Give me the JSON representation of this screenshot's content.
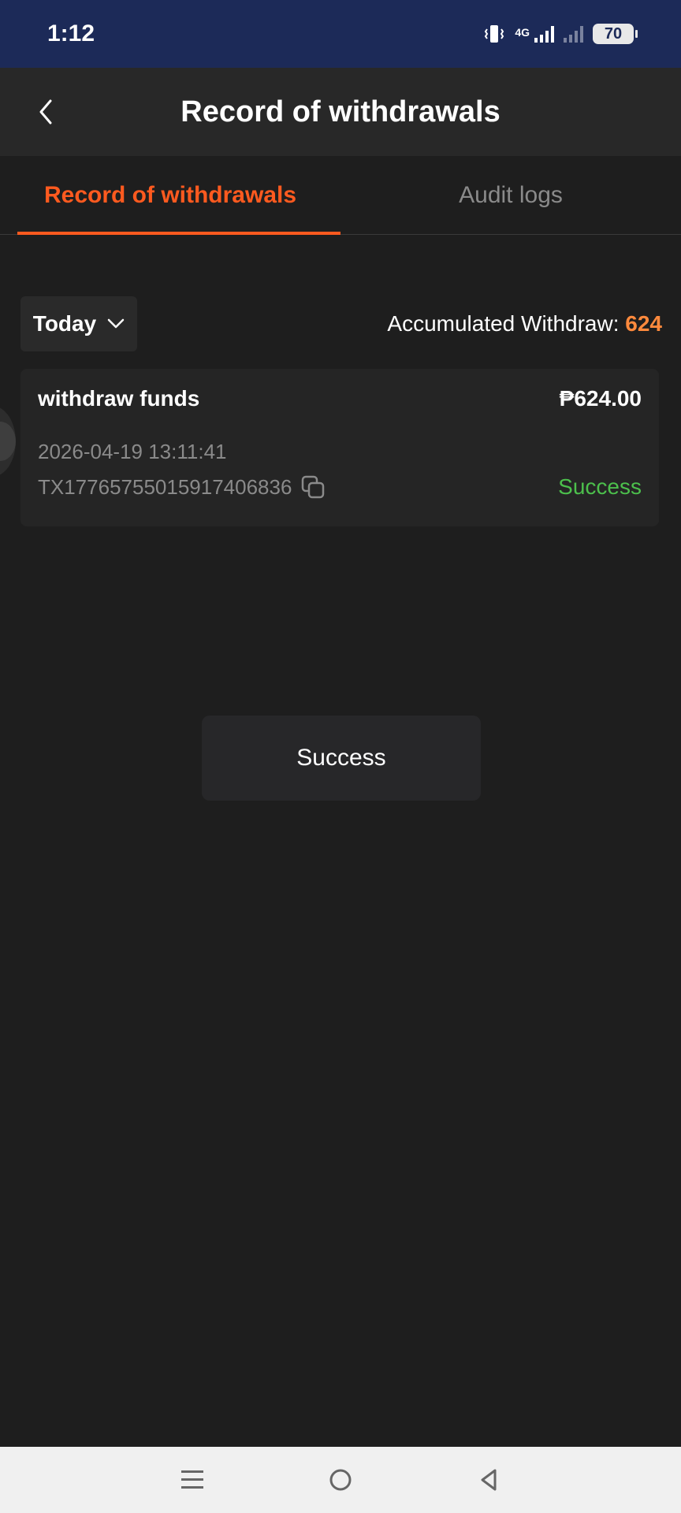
{
  "status_bar": {
    "time": "1:12",
    "network": "4G",
    "battery": "70"
  },
  "header": {
    "title": "Record of withdrawals"
  },
  "tabs": [
    {
      "label": "Record of withdrawals",
      "active": true
    },
    {
      "label": "Audit logs",
      "active": false
    }
  ],
  "filter": {
    "date_label": "Today",
    "accumulated_label": "Accumulated Withdraw: ",
    "accumulated_value": "624"
  },
  "records": [
    {
      "type": "withdraw funds",
      "amount": "₱624.00",
      "datetime": "2026-04-19 13:11:41",
      "tx_id": "TX17765755015917406836",
      "status": "Success"
    }
  ],
  "toast": {
    "message": "Success"
  },
  "colors": {
    "accent": "#ff5a1f",
    "accum_value": "#ff8a3d",
    "success": "#4cbf4c",
    "status_bar": "#1c2a58"
  },
  "icons": {
    "back": "chevron-left-icon",
    "dropdown": "chevron-down-icon",
    "copy": "copy-icon",
    "nav_menu": "menu-icon",
    "nav_home": "home-circle-icon",
    "nav_back": "back-triangle-icon"
  }
}
